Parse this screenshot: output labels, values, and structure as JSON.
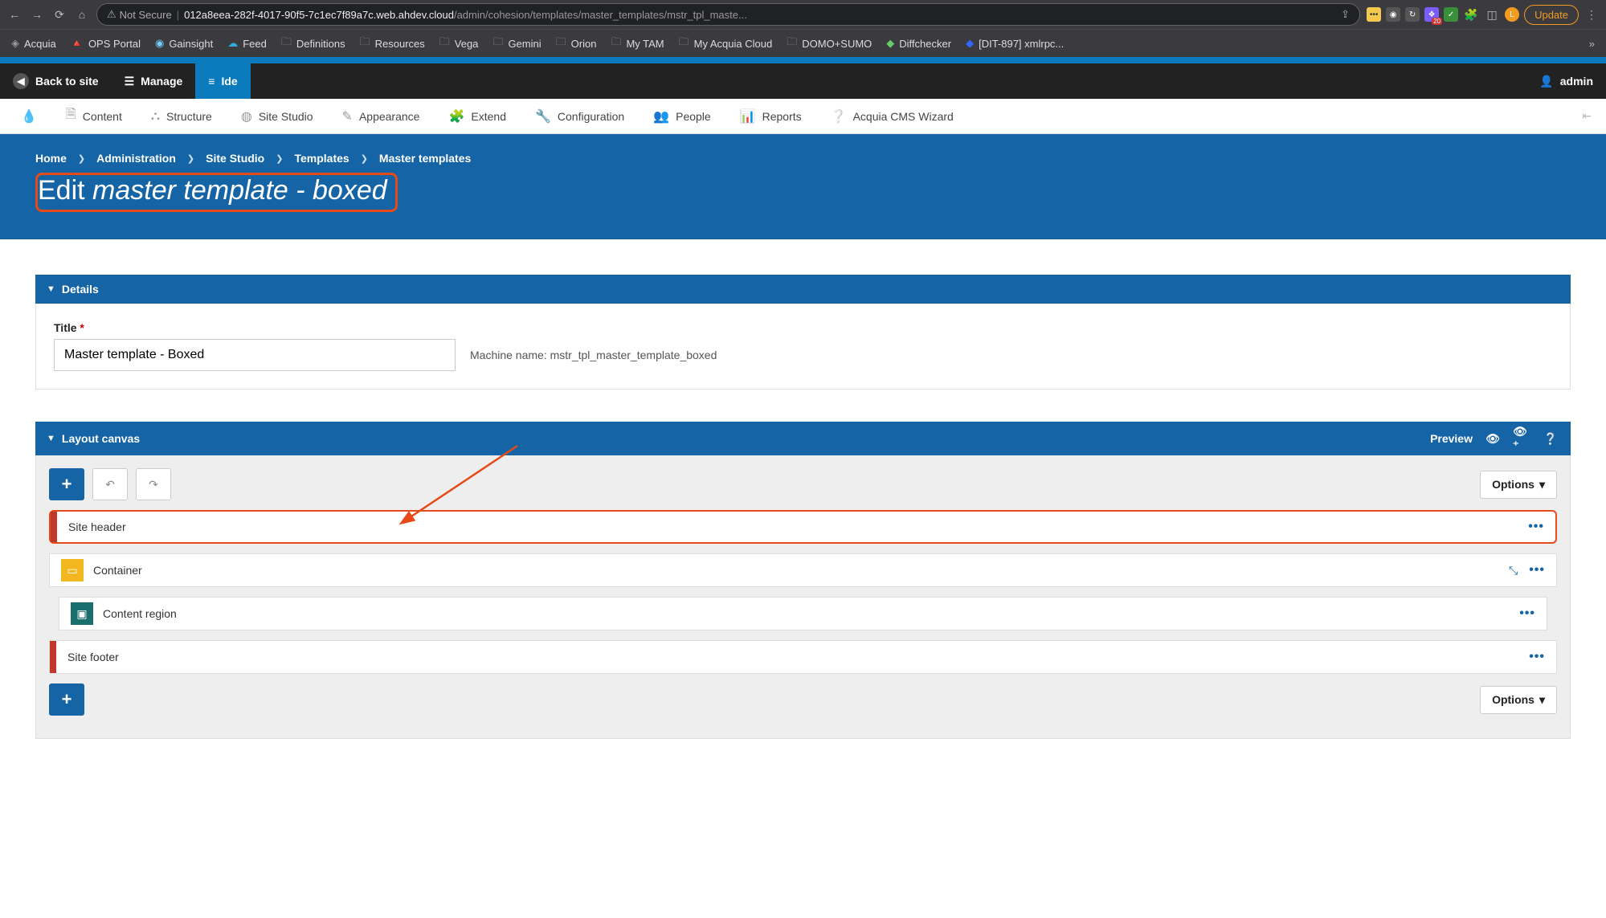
{
  "browser": {
    "not_secure": "Not Secure",
    "url_host": "012a8eea-282f-4017-90f5-7c1ec7f89a7c.web.ahdev.cloud",
    "url_path": "/admin/cohesion/templates/master_templates/mstr_tpl_maste...",
    "update": "Update",
    "ext_badge": "20",
    "avatar": "L",
    "bookmarks": [
      "Acquia",
      "OPS Portal",
      "Gainsight",
      "Feed",
      "Definitions",
      "Resources",
      "Vega",
      "Gemini",
      "Orion",
      "My TAM",
      "My Acquia Cloud",
      "DOMO+SUMO",
      "Diffchecker",
      "[DIT-897] xmlrpc..."
    ]
  },
  "toolbar": {
    "back_to_site": "Back to site",
    "manage": "Manage",
    "ide": "Ide",
    "user": "admin"
  },
  "admin_menu": [
    "Content",
    "Structure",
    "Site Studio",
    "Appearance",
    "Extend",
    "Configuration",
    "People",
    "Reports",
    "Acquia CMS Wizard"
  ],
  "breadcrumbs": [
    "Home",
    "Administration",
    "Site Studio",
    "Templates",
    "Master templates"
  ],
  "page": {
    "title_prefix": "Edit ",
    "title_italic": "master template - boxed"
  },
  "details": {
    "panel": "Details",
    "title_label": "Title",
    "title_value": "Master template - Boxed",
    "machine_label": "Machine name:",
    "machine_value": "mstr_tpl_master_template_boxed"
  },
  "layout": {
    "panel": "Layout canvas",
    "preview": "Preview",
    "options": "Options",
    "items": {
      "site_header": "Site header",
      "container": "Container",
      "content_region": "Content region",
      "site_footer": "Site footer"
    }
  }
}
